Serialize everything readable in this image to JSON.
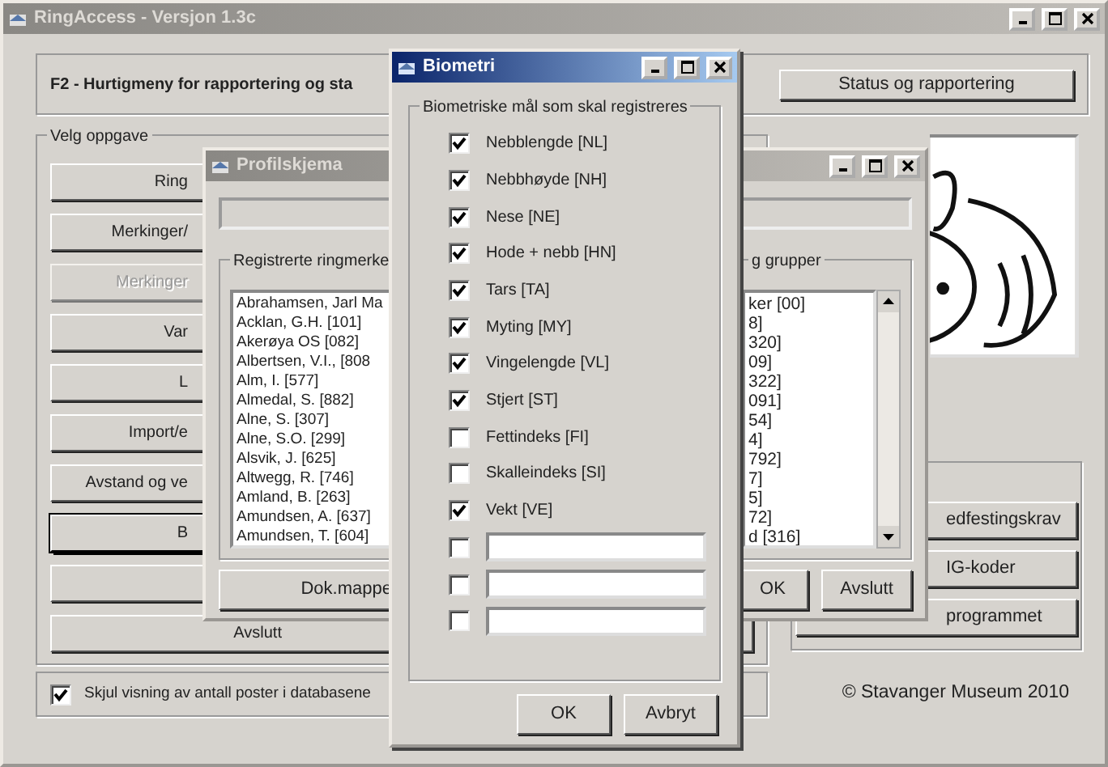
{
  "main_window": {
    "title": "RingAccess - Versjon 1.3c",
    "active": false,
    "header": "F2 - Hurtigmeny for rapportering og sta",
    "status_button": "Status og rapportering",
    "task_group": {
      "title": "Velg oppgave",
      "buttons": [
        {
          "label": "Ring",
          "disabled": false,
          "focused": false
        },
        {
          "label": "Merkinger/",
          "disabled": false,
          "focused": false
        },
        {
          "label": "Merkinger",
          "disabled": true,
          "focused": false
        },
        {
          "label": "Var",
          "disabled": false,
          "focused": false
        },
        {
          "label": "L",
          "disabled": false,
          "focused": false
        },
        {
          "label": "Import/e",
          "disabled": false,
          "focused": false
        },
        {
          "label": "Avstand og ve",
          "disabled": false,
          "focused": false
        },
        {
          "label": "B",
          "disabled": false,
          "focused": true
        },
        {
          "disabled": false,
          "focused": false
        },
        {
          "label": "Avslutt",
          "disabled": false,
          "focused": false
        }
      ]
    },
    "side_buttons": [
      "edfestingskrav",
      "IG-koder",
      "programmet"
    ],
    "hide_counts": {
      "label": "Skjul visning av antall poster i databasene",
      "checked": true
    },
    "copyright": "© Stavanger Museum 2010"
  },
  "profile_window": {
    "title": "Profilskjema",
    "active": false,
    "left_group": "Registrerte ringmerke",
    "left_list": [
      "Abrahamsen, Jarl Ma",
      "Acklan, G.H. [101]",
      "Akerøya OS [082]",
      "Albertsen, V.I., [808",
      "Alm, I. [577]",
      "Almedal, S. [882]",
      "Alne, S. [307]",
      "Alne, S.O. [299]",
      "Alsvik, J. [625]",
      "Altwegg, R. [746]",
      "Amland, B. [263]",
      "Amundsen, A. [637]",
      "Amundsen, T. [604]"
    ],
    "right_group": "g grupper",
    "right_list": [
      "ker [00]",
      "8]",
      "320]",
      "09]",
      "322]",
      "091]",
      "54]",
      "4]",
      "792]",
      "7]",
      "5]",
      "72]",
      "d [316]"
    ],
    "buttons": [
      "Dok.mappe",
      "OK",
      "Avslutt"
    ]
  },
  "biometry_window": {
    "title": "Biometri",
    "active": true,
    "group": "Biometriske mål som skal registreres",
    "measures": [
      {
        "kind": "label",
        "label": "Nebblengde [NL]",
        "checked": true
      },
      {
        "kind": "label",
        "label": "Nebbhøyde [NH]",
        "checked": true
      },
      {
        "kind": "label",
        "label": "Nese [NE]",
        "checked": true
      },
      {
        "kind": "label",
        "label": "Hode + nebb [HN]",
        "checked": true
      },
      {
        "kind": "label",
        "label": "Tars [TA]",
        "checked": true
      },
      {
        "kind": "label",
        "label": "Myting [MY]",
        "checked": true
      },
      {
        "kind": "label",
        "label": "Vingelengde [VL]",
        "checked": true
      },
      {
        "kind": "label",
        "label": "Stjert [ST]",
        "checked": true
      },
      {
        "kind": "label",
        "label": "Fettindeks [FI]",
        "checked": false
      },
      {
        "kind": "label",
        "label": "Skalleindeks [SI]",
        "checked": false
      },
      {
        "kind": "label",
        "label": "Vekt [VE]",
        "checked": true
      },
      {
        "kind": "input",
        "checked": false
      },
      {
        "kind": "input",
        "checked": false
      },
      {
        "kind": "input",
        "checked": false
      }
    ],
    "buttons": [
      "OK",
      "Avbryt"
    ]
  }
}
